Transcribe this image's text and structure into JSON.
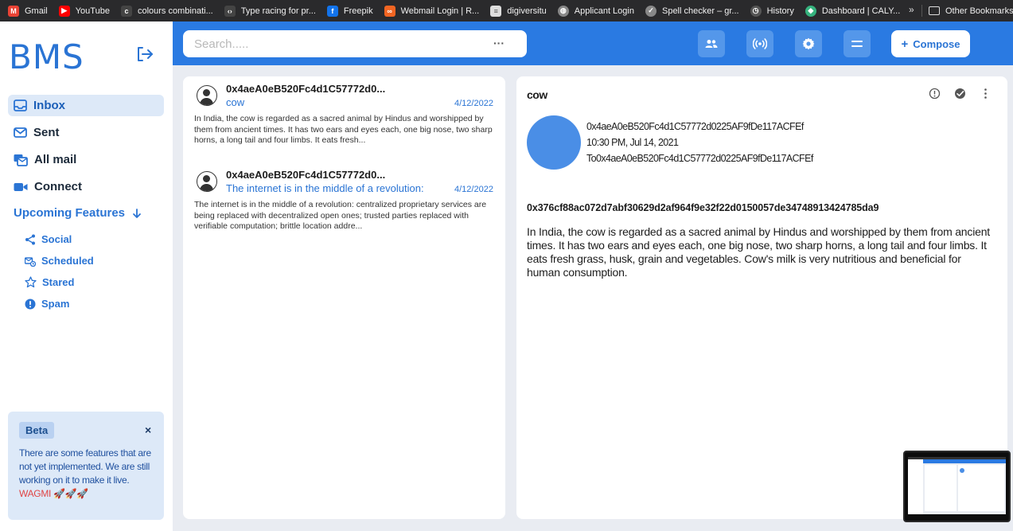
{
  "bookmarks": {
    "items": [
      {
        "label": "Gmail",
        "icon": "gmail-icon",
        "color": "#ea4335"
      },
      {
        "label": "YouTube",
        "icon": "youtube-icon",
        "color": "#ff0000"
      },
      {
        "label": "colours combinati...",
        "icon": "colours-icon",
        "color": "#444444"
      },
      {
        "label": "Type racing for pr...",
        "icon": "code-icon",
        "color": "#444444"
      },
      {
        "label": "Freepik",
        "icon": "freepik-icon",
        "color": "#1273eb"
      },
      {
        "label": "Webmail Login | R...",
        "icon": "webmail-icon",
        "color": "#f26522"
      },
      {
        "label": "digiversitu",
        "icon": "document-icon",
        "color": "#dddddd"
      },
      {
        "label": "Applicant Login",
        "icon": "globe-icon",
        "color": "#888888"
      },
      {
        "label": "Spell checker – gr...",
        "icon": "spellcheck-icon",
        "color": "#888888"
      },
      {
        "label": "History",
        "icon": "history-icon",
        "color": "#888888"
      },
      {
        "label": "Dashboard | CALY...",
        "icon": "dashboard-icon",
        "color": "#36b37e"
      }
    ],
    "more": "»",
    "other": "Other Bookmarks"
  },
  "sidebar": {
    "logo": "BMS",
    "nav": [
      {
        "label": "Inbox",
        "icon": "inbox-icon",
        "active": true
      },
      {
        "label": "Sent",
        "icon": "sent-icon",
        "active": false
      },
      {
        "label": "All mail",
        "icon": "all-mail-icon",
        "active": false
      },
      {
        "label": "Connect",
        "icon": "video-icon",
        "active": false
      }
    ],
    "upcoming_label": "Upcoming Features",
    "sub": [
      {
        "label": "Social",
        "icon": "share-icon"
      },
      {
        "label": "Scheduled",
        "icon": "scheduled-icon"
      },
      {
        "label": "Stared",
        "icon": "star-icon"
      },
      {
        "label": "Spam",
        "icon": "spam-icon"
      }
    ],
    "beta": {
      "tag": "Beta",
      "close": "×",
      "text": "There are some features that are not yet implemented. We are still working on it to make it live.",
      "wagmi": "WAGMI 🚀🚀🚀"
    }
  },
  "header": {
    "search_placeholder": "Search.....",
    "search_more": "···",
    "compose_label": "Compose",
    "compose_plus": "+",
    "accent": "#2a7ae2"
  },
  "mails": [
    {
      "from": "0x4aeA0eB520Fc4d1C57772d0...",
      "subject": "cow",
      "date": "4/12/2022",
      "snippet": "In India, the cow is regarded as a sacred animal by Hindus and worshipped by them from ancient times. It has two ears and eyes each, one big nose, two sharp horns, a long tail and four limbs. It eats fresh..."
    },
    {
      "from": "0x4aeA0eB520Fc4d1C57772d0...",
      "subject": "The internet is in the middle of a revolution:",
      "date": "4/12/2022",
      "snippet": "The internet is in the middle of a revolution: centralized proprietary services are being replaced with decentralized open ones; trusted parties replaced with verifiable computation; brittle location addre..."
    }
  ],
  "reader": {
    "subject": "cow",
    "from": "0x4aeA0eB520Fc4d1C57772d0225AF9fDe117ACFEf",
    "datetime": "10:30 PM, Jul 14, 2021",
    "to": "To0x4aeA0eB520Fc4d1C57772d0225AF9fDe117ACFEf",
    "hash": "0x376cf88ac072d7abf30629d2af964f9e32f22d0150057de34748913424785da9",
    "body": "In India, the cow is regarded as a sacred animal by Hindus and worshipped by them from ancient times. It has two ears and eyes each, one big nose, two sharp horns, a long tail and four limbs. It eats fresh grass, husk, grain and vegetables. Cow's milk is very nutritious and beneficial for human consumption."
  }
}
